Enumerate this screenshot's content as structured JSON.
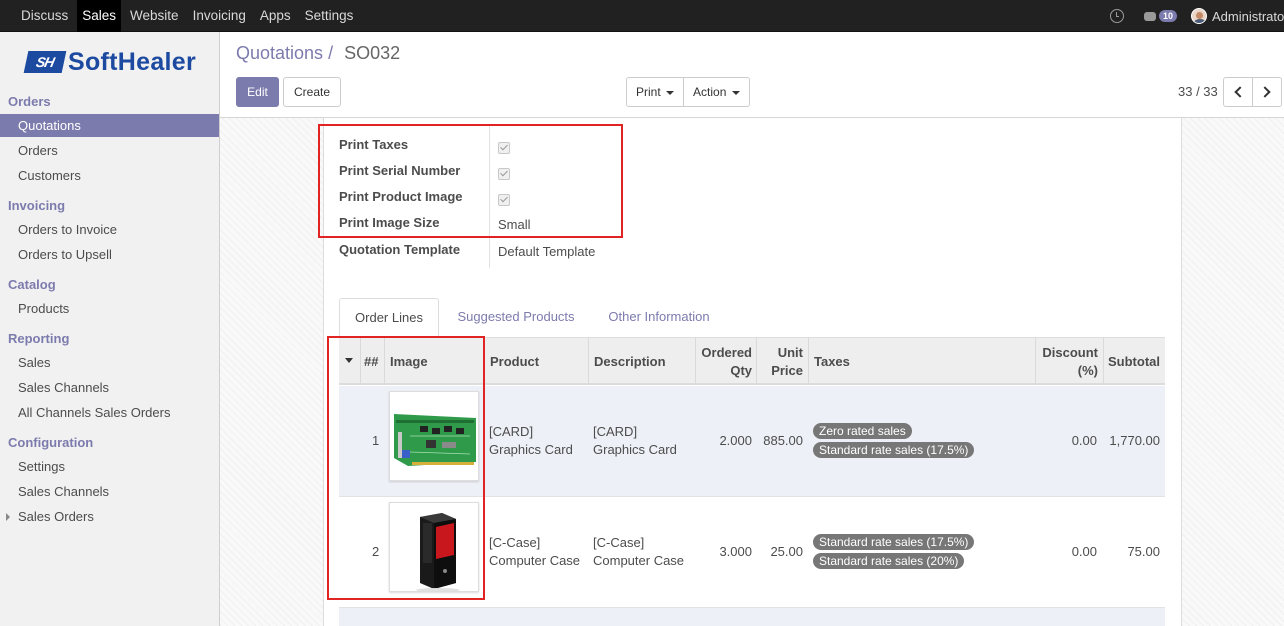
{
  "topbar": {
    "menu": [
      "Discuss",
      "Sales",
      "Website",
      "Invoicing",
      "Apps",
      "Settings"
    ],
    "active": "Sales",
    "messages_count": "10",
    "user": "Administrator"
  },
  "brand": {
    "mark": "SH",
    "name": "SoftHealer"
  },
  "sidebar": {
    "orders": {
      "title": "Orders",
      "items": [
        "Quotations",
        "Orders",
        "Customers"
      ]
    },
    "invoicing": {
      "title": "Invoicing",
      "items": [
        "Orders to Invoice",
        "Orders to Upsell"
      ]
    },
    "catalog": {
      "title": "Catalog",
      "items": [
        "Products"
      ]
    },
    "reporting": {
      "title": "Reporting",
      "items": [
        "Sales",
        "Sales Channels",
        "All Channels Sales Orders"
      ]
    },
    "configuration": {
      "title": "Configuration",
      "items": [
        "Settings",
        "Sales Channels",
        "Sales Orders"
      ]
    }
  },
  "breadcrumb": {
    "parent": "Quotations",
    "separator": "/",
    "current": "SO032"
  },
  "buttons": {
    "edit": "Edit",
    "create": "Create",
    "print": "Print",
    "action": "Action"
  },
  "pager": {
    "value": "33 / 33"
  },
  "form": {
    "print_taxes": {
      "label": "Print Taxes",
      "checked": true
    },
    "print_serial": {
      "label": "Print Serial Number",
      "checked": true
    },
    "print_image": {
      "label": "Print Product Image",
      "checked": true
    },
    "image_size": {
      "label": "Print Image Size",
      "value": "Small"
    },
    "template": {
      "label": "Quotation Template",
      "value": "Default Template"
    }
  },
  "tabs": [
    "Order Lines",
    "Suggested Products",
    "Other Information"
  ],
  "table": {
    "headers": {
      "serial": "##",
      "image": "Image",
      "product": "Product",
      "description": "Description",
      "qty_1": "Ordered",
      "qty_2": "Qty",
      "price_1": "Unit",
      "price_2": "Price",
      "taxes": "Taxes",
      "discount_1": "Discount",
      "discount_2": "(%)",
      "subtotal": "Subtotal"
    },
    "rows": [
      {
        "serial": "1",
        "product_1": "[CARD]",
        "product_2": "Graphics Card",
        "desc_1": "[CARD]",
        "desc_2": "Graphics Card",
        "qty": "2.000",
        "price": "885.00",
        "taxes": [
          "Zero rated sales",
          "Standard rate sales (17.5%)"
        ],
        "discount": "0.00",
        "subtotal": "1,770.00"
      },
      {
        "serial": "2",
        "product_1": "[C-Case]",
        "product_2": "Computer Case",
        "desc_1": "[C-Case]",
        "desc_2": "Computer Case",
        "qty": "3.000",
        "price": "25.00",
        "taxes": [
          "Standard rate sales (17.5%)",
          "Standard rate sales (20%)"
        ],
        "discount": "0.00",
        "subtotal": "75.00"
      }
    ]
  },
  "colors": {
    "accent": "#7c7bad",
    "highlight": "#e02424",
    "navbar": "#212121"
  }
}
